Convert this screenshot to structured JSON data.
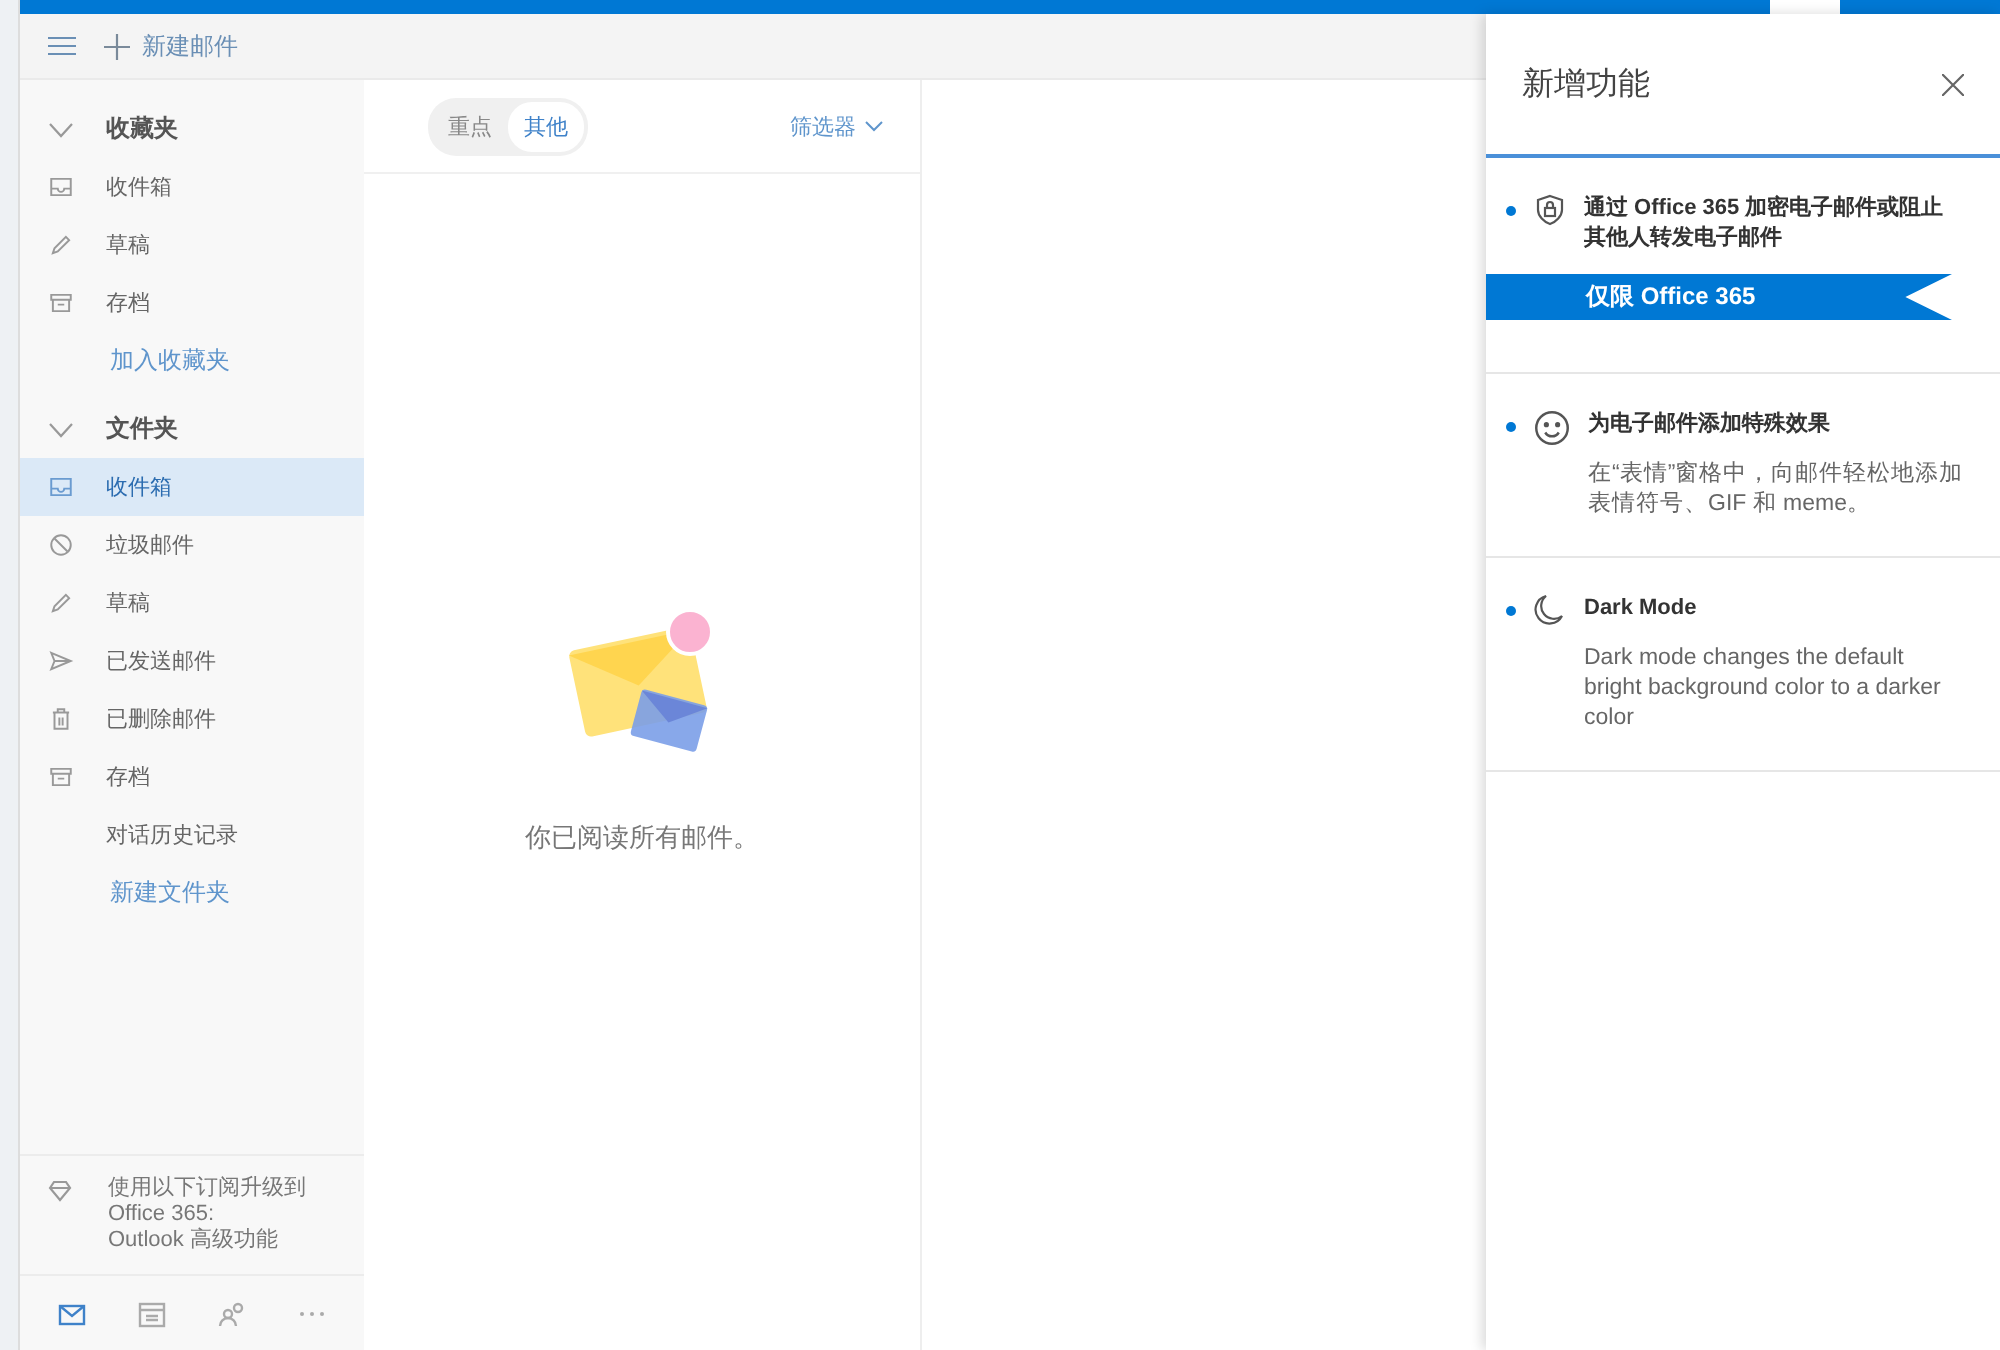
{
  "toolbar": {
    "compose_label": "新建邮件"
  },
  "sidebar": {
    "sections": [
      {
        "title": "收藏夹",
        "expanded": true,
        "items": [
          {
            "kind": "inbox",
            "label": "收件箱",
            "selected": false
          },
          {
            "kind": "pencil",
            "label": "草稿",
            "selected": false
          },
          {
            "kind": "archive",
            "label": "存档",
            "selected": false
          }
        ],
        "link": "加入收藏夹"
      },
      {
        "title": "文件夹",
        "expanded": true,
        "items": [
          {
            "kind": "inbox",
            "label": "收件箱",
            "selected": true
          },
          {
            "kind": "blocked",
            "label": "垃圾邮件",
            "selected": false
          },
          {
            "kind": "pencil",
            "label": "草稿",
            "selected": false
          },
          {
            "kind": "sent",
            "label": "已发送邮件",
            "selected": false
          },
          {
            "kind": "trash",
            "label": "已删除邮件",
            "selected": false
          },
          {
            "kind": "archive",
            "label": "存档",
            "selected": false
          },
          {
            "kind": "plain",
            "label": "对话历史记录",
            "selected": false
          }
        ],
        "link": "新建文件夹"
      }
    ],
    "upgrade": {
      "lines": [
        "使用以下订阅升级到",
        "Office 365:",
        "Outlook 高级功能"
      ]
    },
    "bottom_nav": [
      {
        "kind": "mail",
        "selected": true
      },
      {
        "kind": "calendar",
        "selected": false
      },
      {
        "kind": "people",
        "selected": false
      },
      {
        "kind": "more",
        "selected": false
      }
    ]
  },
  "message_list": {
    "tabs": [
      {
        "label": "重点",
        "selected": false
      },
      {
        "label": "其他",
        "selected": true
      }
    ],
    "filter": "筛选器",
    "empty_message": "你已阅读所有邮件。"
  },
  "whats_new": {
    "title": "新增功能",
    "features": [
      {
        "kind": "shield-lock",
        "title": "通过 Office 365 加密电子邮件或阻止其他人转发电子邮件",
        "badge": "仅限 Office 365"
      },
      {
        "kind": "smiley",
        "title": "为电子邮件添加特殊效果",
        "description": "在“表情”窗格中，向邮件轻松地添加表情符号、GIF 和 meme。"
      },
      {
        "kind": "moon",
        "title": "Dark Mode",
        "description": "Dark mode changes the default bright background color to a darker color"
      }
    ]
  }
}
